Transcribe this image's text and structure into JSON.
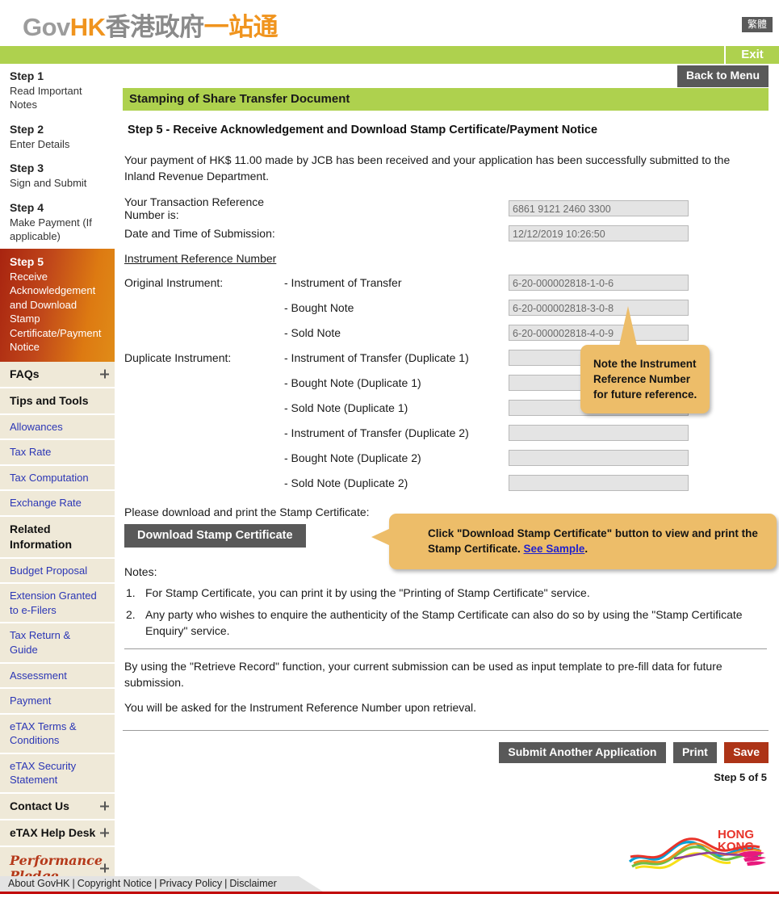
{
  "header": {
    "logo_gov": "Gov",
    "logo_hk": "HK",
    "logo_cn_gray": "香港政府",
    "logo_cn_orange": "一站通",
    "lang_button": "繁體",
    "exit_label": "Exit"
  },
  "sidebar": {
    "steps": [
      {
        "title": "Step 1",
        "desc": "Read Important Notes",
        "active": false
      },
      {
        "title": "Step 2",
        "desc": "Enter Details",
        "active": false
      },
      {
        "title": "Step 3",
        "desc": "Sign and Submit",
        "active": false
      },
      {
        "title": "Step 4",
        "desc": "Make Payment (If applicable)",
        "active": false
      },
      {
        "title": "Step 5",
        "desc": "Receive Acknowledgement and Download Stamp Certificate/Payment Notice",
        "active": true
      }
    ],
    "nav": [
      {
        "label": "FAQs",
        "head": true,
        "expand": true
      },
      {
        "label": "Tips and Tools",
        "head": true,
        "expand": false
      },
      {
        "label": "Allowances",
        "head": false,
        "expand": false
      },
      {
        "label": "Tax Rate",
        "head": false,
        "expand": false
      },
      {
        "label": "Tax Computation",
        "head": false,
        "expand": false
      },
      {
        "label": "Exchange Rate",
        "head": false,
        "expand": false
      },
      {
        "label": "Related Information",
        "head": true,
        "expand": false
      },
      {
        "label": "Budget Proposal",
        "head": false,
        "expand": false
      },
      {
        "label": "Extension Granted to e-Filers",
        "head": false,
        "expand": false
      },
      {
        "label": "Tax Return & Guide",
        "head": false,
        "expand": false
      },
      {
        "label": "Assessment",
        "head": false,
        "expand": false
      },
      {
        "label": "Payment",
        "head": false,
        "expand": false
      },
      {
        "label": "eTAX Terms & Conditions",
        "head": false,
        "expand": false
      },
      {
        "label": "eTAX Security Statement",
        "head": false,
        "expand": false
      },
      {
        "label": "Contact Us",
        "head": true,
        "expand": true
      },
      {
        "label": "eTAX Help Desk",
        "head": true,
        "expand": true
      },
      {
        "label": "Performance Pledge",
        "head": false,
        "expand": true,
        "pledge": true
      }
    ]
  },
  "main": {
    "back_to_menu": "Back to Menu",
    "title_bar": "Stamping of Share Transfer Document",
    "section_title": "Step 5 - Receive Acknowledgement and Download Stamp Certificate/Payment Notice",
    "intro": "Your payment of HK$ 11.00 made by JCB has been received and your application has been successfully submitted to the Inland Revenue Department.",
    "fields": {
      "txn_label": "Your Transaction Reference Number is:",
      "txn_value": "6861 9121 2460 3300",
      "date_label": "Date and Time of Submission:",
      "date_value": "12/12/2019 10:26:50",
      "irn_heading": "Instrument Reference Number",
      "original_label": "Original Instrument:",
      "duplicate_label": "Duplicate Instrument:",
      "original_rows": [
        {
          "sub": "- Instrument of Transfer",
          "value": "6-20-000002818-1-0-6"
        },
        {
          "sub": "- Bought Note",
          "value": "6-20-000002818-3-0-8"
        },
        {
          "sub": "- Sold Note",
          "value": "6-20-000002818-4-0-9"
        }
      ],
      "duplicate_rows": [
        {
          "sub": "- Instrument of Transfer (Duplicate 1)",
          "value": ""
        },
        {
          "sub": "- Bought Note (Duplicate 1)",
          "value": ""
        },
        {
          "sub": "- Sold Note (Duplicate 1)",
          "value": ""
        },
        {
          "sub": "- Instrument of Transfer (Duplicate 2)",
          "value": ""
        },
        {
          "sub": "- Bought Note (Duplicate 2)",
          "value": ""
        },
        {
          "sub": "- Sold Note (Duplicate 2)",
          "value": ""
        }
      ]
    },
    "callout_irn": "Note the Instrument Reference Number for future reference.",
    "callout_download_pre": "Click \"Download Stamp Certificate\" button to view and print the Stamp Certificate. ",
    "callout_download_link": "See Sample",
    "callout_download_post": ".",
    "download_label": "Please download and print the Stamp Certificate:",
    "download_button": "Download Stamp Certificate",
    "notes_title": "Notes:",
    "notes": [
      {
        "num": "1.",
        "text": "For Stamp Certificate, you can print it by using the \"Printing of Stamp Certificate\" service."
      },
      {
        "num": "2.",
        "text": "Any party who wishes to enquire the authenticity of the Stamp Certificate can also do so by using the \"Stamp Certificate Enquiry\" service."
      }
    ],
    "para_retrieve": "By using the \"Retrieve Record\" function, your current submission can be used as input template to pre-fill data for future submission.",
    "para_ask": "You will be asked for the Instrument Reference Number upon retrieval.",
    "actions": {
      "submit_another": "Submit Another Application",
      "print": "Print",
      "save": "Save"
    },
    "step_count": "Step 5 of 5"
  },
  "footer": {
    "links": [
      "About GovHK",
      "Copyright Notice",
      "Privacy Policy",
      "Disclaimer"
    ],
    "brand_line1": "HONG",
    "brand_line2": "KONG"
  },
  "colors": {
    "green": "#aed14e",
    "orange_accent": "#f0941e",
    "callout": "#edbd69",
    "save_red": "#ad3417",
    "sidebar_beige": "#efe9d8",
    "link_blue": "#2b36b5",
    "footer_red": "#c00000"
  }
}
